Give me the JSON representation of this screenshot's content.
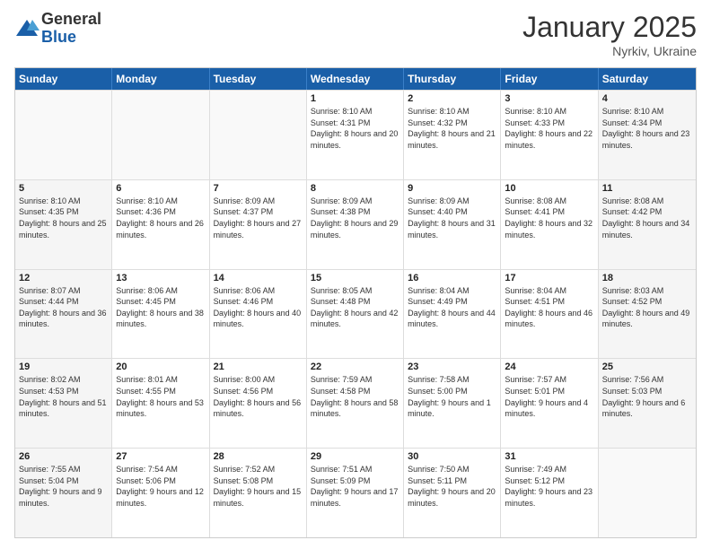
{
  "logo": {
    "general": "General",
    "blue": "Blue"
  },
  "header": {
    "month": "January 2025",
    "location": "Nyrkiv, Ukraine"
  },
  "weekdays": [
    "Sunday",
    "Monday",
    "Tuesday",
    "Wednesday",
    "Thursday",
    "Friday",
    "Saturday"
  ],
  "rows": [
    [
      {
        "day": "",
        "sunrise": "",
        "sunset": "",
        "daylight": "",
        "empty": true
      },
      {
        "day": "",
        "sunrise": "",
        "sunset": "",
        "daylight": "",
        "empty": true
      },
      {
        "day": "",
        "sunrise": "",
        "sunset": "",
        "daylight": "",
        "empty": true
      },
      {
        "day": "1",
        "sunrise": "Sunrise: 8:10 AM",
        "sunset": "Sunset: 4:31 PM",
        "daylight": "Daylight: 8 hours and 20 minutes."
      },
      {
        "day": "2",
        "sunrise": "Sunrise: 8:10 AM",
        "sunset": "Sunset: 4:32 PM",
        "daylight": "Daylight: 8 hours and 21 minutes."
      },
      {
        "day": "3",
        "sunrise": "Sunrise: 8:10 AM",
        "sunset": "Sunset: 4:33 PM",
        "daylight": "Daylight: 8 hours and 22 minutes."
      },
      {
        "day": "4",
        "sunrise": "Sunrise: 8:10 AM",
        "sunset": "Sunset: 4:34 PM",
        "daylight": "Daylight: 8 hours and 23 minutes."
      }
    ],
    [
      {
        "day": "5",
        "sunrise": "Sunrise: 8:10 AM",
        "sunset": "Sunset: 4:35 PM",
        "daylight": "Daylight: 8 hours and 25 minutes."
      },
      {
        "day": "6",
        "sunrise": "Sunrise: 8:10 AM",
        "sunset": "Sunset: 4:36 PM",
        "daylight": "Daylight: 8 hours and 26 minutes."
      },
      {
        "day": "7",
        "sunrise": "Sunrise: 8:09 AM",
        "sunset": "Sunset: 4:37 PM",
        "daylight": "Daylight: 8 hours and 27 minutes."
      },
      {
        "day": "8",
        "sunrise": "Sunrise: 8:09 AM",
        "sunset": "Sunset: 4:38 PM",
        "daylight": "Daylight: 8 hours and 29 minutes."
      },
      {
        "day": "9",
        "sunrise": "Sunrise: 8:09 AM",
        "sunset": "Sunset: 4:40 PM",
        "daylight": "Daylight: 8 hours and 31 minutes."
      },
      {
        "day": "10",
        "sunrise": "Sunrise: 8:08 AM",
        "sunset": "Sunset: 4:41 PM",
        "daylight": "Daylight: 8 hours and 32 minutes."
      },
      {
        "day": "11",
        "sunrise": "Sunrise: 8:08 AM",
        "sunset": "Sunset: 4:42 PM",
        "daylight": "Daylight: 8 hours and 34 minutes."
      }
    ],
    [
      {
        "day": "12",
        "sunrise": "Sunrise: 8:07 AM",
        "sunset": "Sunset: 4:44 PM",
        "daylight": "Daylight: 8 hours and 36 minutes."
      },
      {
        "day": "13",
        "sunrise": "Sunrise: 8:06 AM",
        "sunset": "Sunset: 4:45 PM",
        "daylight": "Daylight: 8 hours and 38 minutes."
      },
      {
        "day": "14",
        "sunrise": "Sunrise: 8:06 AM",
        "sunset": "Sunset: 4:46 PM",
        "daylight": "Daylight: 8 hours and 40 minutes."
      },
      {
        "day": "15",
        "sunrise": "Sunrise: 8:05 AM",
        "sunset": "Sunset: 4:48 PM",
        "daylight": "Daylight: 8 hours and 42 minutes."
      },
      {
        "day": "16",
        "sunrise": "Sunrise: 8:04 AM",
        "sunset": "Sunset: 4:49 PM",
        "daylight": "Daylight: 8 hours and 44 minutes."
      },
      {
        "day": "17",
        "sunrise": "Sunrise: 8:04 AM",
        "sunset": "Sunset: 4:51 PM",
        "daylight": "Daylight: 8 hours and 46 minutes."
      },
      {
        "day": "18",
        "sunrise": "Sunrise: 8:03 AM",
        "sunset": "Sunset: 4:52 PM",
        "daylight": "Daylight: 8 hours and 49 minutes."
      }
    ],
    [
      {
        "day": "19",
        "sunrise": "Sunrise: 8:02 AM",
        "sunset": "Sunset: 4:53 PM",
        "daylight": "Daylight: 8 hours and 51 minutes."
      },
      {
        "day": "20",
        "sunrise": "Sunrise: 8:01 AM",
        "sunset": "Sunset: 4:55 PM",
        "daylight": "Daylight: 8 hours and 53 minutes."
      },
      {
        "day": "21",
        "sunrise": "Sunrise: 8:00 AM",
        "sunset": "Sunset: 4:56 PM",
        "daylight": "Daylight: 8 hours and 56 minutes."
      },
      {
        "day": "22",
        "sunrise": "Sunrise: 7:59 AM",
        "sunset": "Sunset: 4:58 PM",
        "daylight": "Daylight: 8 hours and 58 minutes."
      },
      {
        "day": "23",
        "sunrise": "Sunrise: 7:58 AM",
        "sunset": "Sunset: 5:00 PM",
        "daylight": "Daylight: 9 hours and 1 minute."
      },
      {
        "day": "24",
        "sunrise": "Sunrise: 7:57 AM",
        "sunset": "Sunset: 5:01 PM",
        "daylight": "Daylight: 9 hours and 4 minutes."
      },
      {
        "day": "25",
        "sunrise": "Sunrise: 7:56 AM",
        "sunset": "Sunset: 5:03 PM",
        "daylight": "Daylight: 9 hours and 6 minutes."
      }
    ],
    [
      {
        "day": "26",
        "sunrise": "Sunrise: 7:55 AM",
        "sunset": "Sunset: 5:04 PM",
        "daylight": "Daylight: 9 hours and 9 minutes."
      },
      {
        "day": "27",
        "sunrise": "Sunrise: 7:54 AM",
        "sunset": "Sunset: 5:06 PM",
        "daylight": "Daylight: 9 hours and 12 minutes."
      },
      {
        "day": "28",
        "sunrise": "Sunrise: 7:52 AM",
        "sunset": "Sunset: 5:08 PM",
        "daylight": "Daylight: 9 hours and 15 minutes."
      },
      {
        "day": "29",
        "sunrise": "Sunrise: 7:51 AM",
        "sunset": "Sunset: 5:09 PM",
        "daylight": "Daylight: 9 hours and 17 minutes."
      },
      {
        "day": "30",
        "sunrise": "Sunrise: 7:50 AM",
        "sunset": "Sunset: 5:11 PM",
        "daylight": "Daylight: 9 hours and 20 minutes."
      },
      {
        "day": "31",
        "sunrise": "Sunrise: 7:49 AM",
        "sunset": "Sunset: 5:12 PM",
        "daylight": "Daylight: 9 hours and 23 minutes."
      },
      {
        "day": "",
        "sunrise": "",
        "sunset": "",
        "daylight": "",
        "empty": true
      }
    ]
  ]
}
